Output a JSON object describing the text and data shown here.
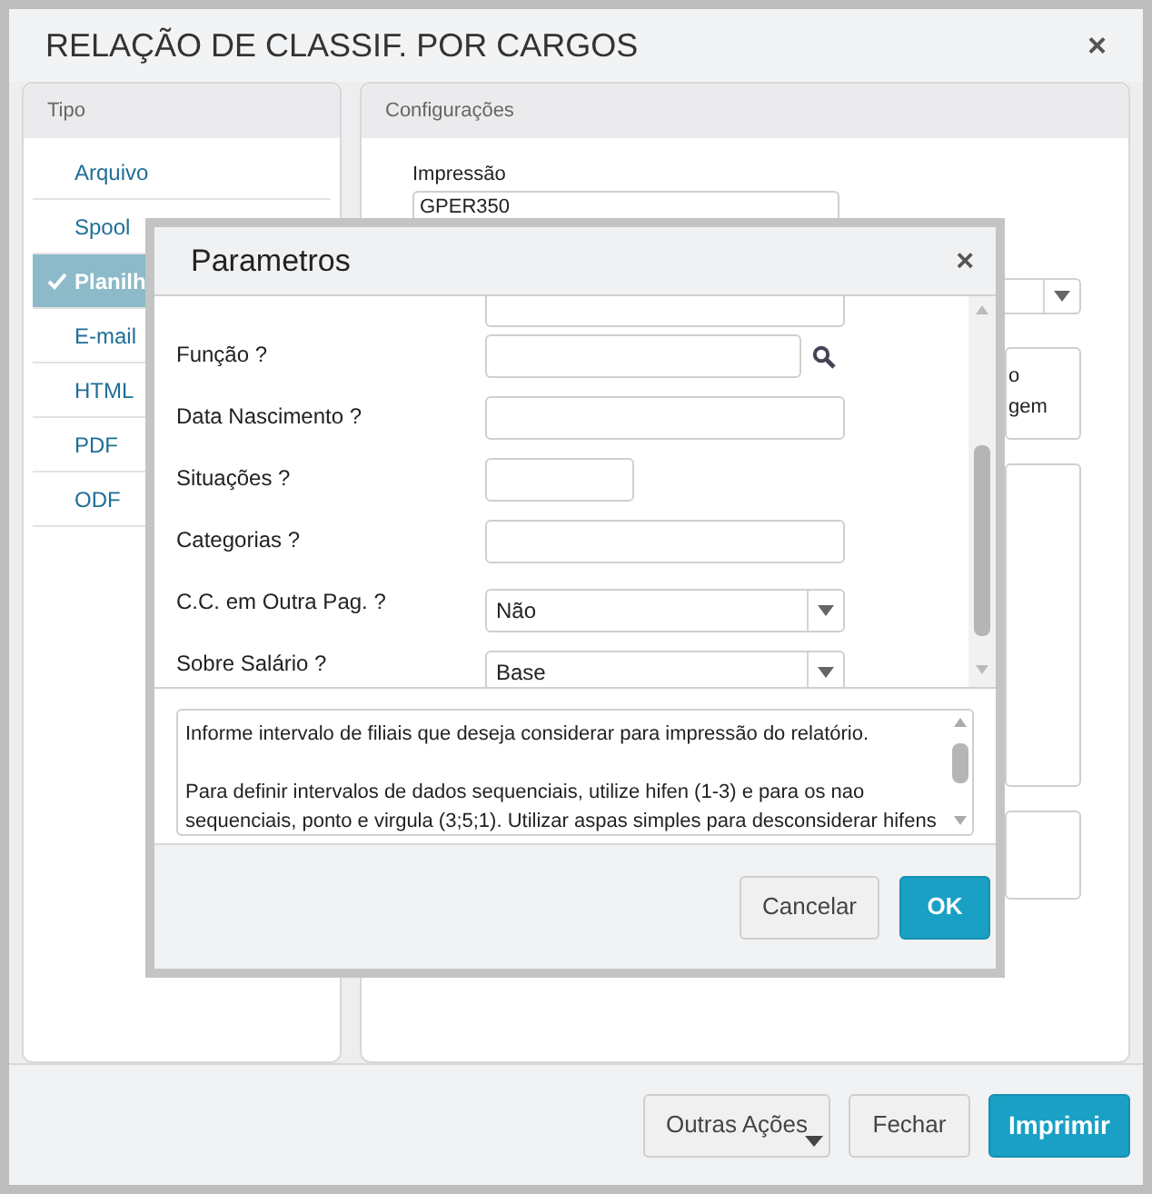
{
  "window": {
    "title": "RELAÇÃO DE CLASSIF. POR CARGOS",
    "close": "×"
  },
  "tipo": {
    "title": "Tipo",
    "items": [
      {
        "label": "Arquivo",
        "selected": false
      },
      {
        "label": "Spool",
        "selected": false
      },
      {
        "label": "Planilh",
        "selected": true
      },
      {
        "label": "E-mail",
        "selected": false
      },
      {
        "label": "HTML",
        "selected": false
      },
      {
        "label": "PDF",
        "selected": false
      },
      {
        "label": "ODF",
        "selected": false
      }
    ]
  },
  "config": {
    "title": "Configurações",
    "impressao_label": "Impressão",
    "impressao_value": "GPER350",
    "option_lines": [
      "o",
      "gem"
    ]
  },
  "dialog": {
    "title": "Parametros",
    "close": "×",
    "fields": [
      {
        "kind": "lookup",
        "label": "Função ?"
      },
      {
        "kind": "text",
        "label": "Data Nascimento ?"
      },
      {
        "kind": "short",
        "label": "Situações ?"
      },
      {
        "kind": "text",
        "label": "Categorias ?"
      },
      {
        "kind": "select",
        "label": "C.C. em Outra Pag. ?",
        "value": "Não"
      },
      {
        "kind": "select",
        "label": "Sobre Salário ?",
        "value": "Base"
      }
    ],
    "help": [
      "Informe intervalo de filiais que deseja considerar para impressão do relatório.",
      "Para definir intervalos de dados sequenciais, utilize hifen (1-3) e para os nao sequenciais, ponto e virgula (3;5;1). Utilizar aspas simples para desconsiderar hifens"
    ],
    "buttons": [
      {
        "label": "Cancelar",
        "kind": "default"
      },
      {
        "label": "OK",
        "kind": "primary"
      }
    ]
  },
  "footer_buttons": [
    {
      "label": "Outras Ações",
      "kind": "menu"
    },
    {
      "label": "Fechar",
      "kind": "default"
    },
    {
      "label": "Imprimir",
      "kind": "primary"
    }
  ]
}
